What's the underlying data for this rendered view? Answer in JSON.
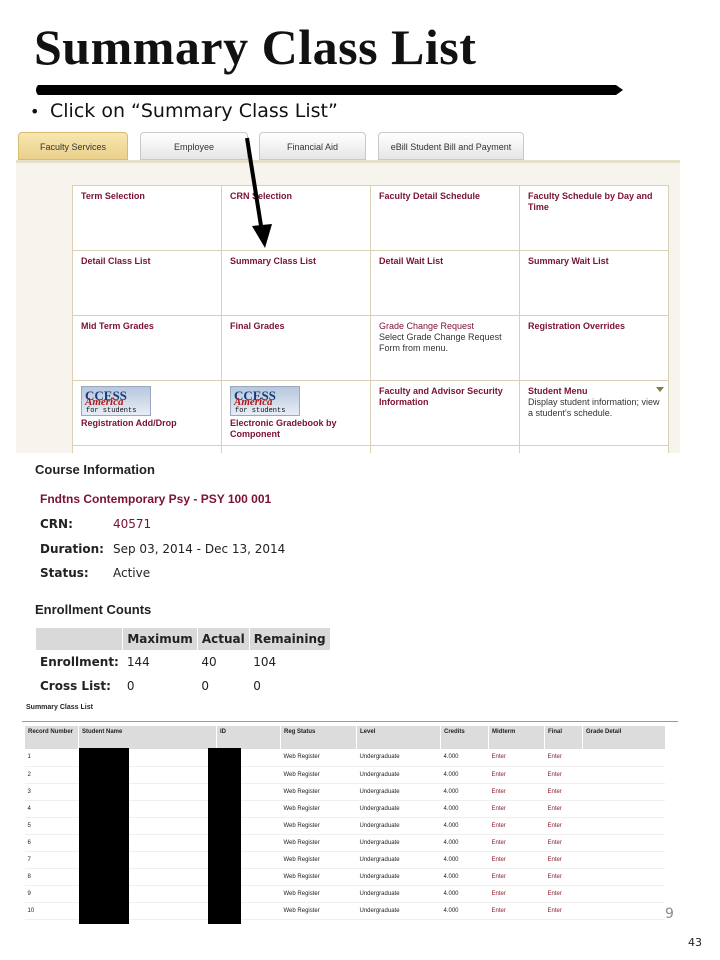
{
  "slide": {
    "title": "Summary Class List",
    "bullet": "Click on “Summary Class List”",
    "page_number": "9",
    "slide_number": "43"
  },
  "tabs": [
    {
      "label": "Faculty Services",
      "active": true
    },
    {
      "label": "Employee",
      "active": false
    },
    {
      "label": "Financial Aid",
      "active": false
    },
    {
      "label": "eBill Student Bill and Payment",
      "active": false
    }
  ],
  "menu": {
    "r1": [
      "Term Selection",
      "CRN Selection",
      "Faculty Detail Schedule",
      "Faculty Schedule by Day and Time"
    ],
    "r2": [
      "Detail Class List",
      "Summary Class List",
      "Detail Wait List",
      "Summary Wait List"
    ],
    "r3": {
      "c1": "Mid Term Grades",
      "c2": "Final Grades",
      "c3_link": "Grade Change Request",
      "c3_desc": "Select Grade Change Request Form from menu.",
      "c4": "Registration Overrides"
    },
    "r4": {
      "logo": {
        "line1": "CCESS",
        "line2": "America",
        "line3": "for students"
      },
      "c1": "Registration Add/Drop",
      "c2": "Electronic Gradebook by Component",
      "c3": "Faculty and Advisor Security Information",
      "c4_link": "Student Menu",
      "c4_desc": "Display student information; view a student's schedule."
    }
  },
  "course": {
    "heading": "Course Information",
    "title": "Fndtns Contemporary Psy - PSY 100 001",
    "crn_label": "CRN:",
    "crn": "40571",
    "duration_label": "Duration:",
    "duration": "Sep 03, 2014 - Dec 13, 2014",
    "status_label": "Status:",
    "status": "Active"
  },
  "enrollment": {
    "heading": "Enrollment Counts",
    "columns": [
      "Maximum",
      "Actual",
      "Remaining"
    ],
    "rows": [
      {
        "label": "Enrollment:",
        "values": [
          "144",
          "40",
          "104"
        ]
      },
      {
        "label": "Cross List:",
        "values": [
          "0",
          "0",
          "0"
        ]
      }
    ]
  },
  "class_list": {
    "title": "Summary Class List",
    "headers": [
      "Record Number",
      "Student Name",
      "ID",
      "Reg Status",
      "Level",
      "Credits",
      "Midterm",
      "Final",
      "Grade Detail"
    ],
    "rows": [
      [
        "1",
        "",
        "",
        "Web Register",
        "Undergraduate",
        "4.000",
        "Enter",
        "Enter",
        ""
      ],
      [
        "2",
        "",
        "",
        "Web Register",
        "Undergraduate",
        "4.000",
        "Enter",
        "Enter",
        ""
      ],
      [
        "3",
        "",
        "",
        "Web Register",
        "Undergraduate",
        "4.000",
        "Enter",
        "Enter",
        ""
      ],
      [
        "4",
        "",
        "",
        "Web Register",
        "Undergraduate",
        "4.000",
        "Enter",
        "Enter",
        ""
      ],
      [
        "5",
        "",
        "",
        "Web Register",
        "Undergraduate",
        "4.000",
        "Enter",
        "Enter",
        ""
      ],
      [
        "6",
        "",
        "",
        "Web Register",
        "Undergraduate",
        "4.000",
        "Enter",
        "Enter",
        ""
      ],
      [
        "7",
        "",
        "",
        "Web Register",
        "Undergraduate",
        "4.000",
        "Enter",
        "Enter",
        ""
      ],
      [
        "8",
        "",
        "",
        "Web Register",
        "Undergraduate",
        "4.000",
        "Enter",
        "Enter",
        ""
      ],
      [
        "9",
        "",
        "",
        "Web Register",
        "Undergraduate",
        "4.000",
        "Enter",
        "Enter",
        ""
      ],
      [
        "10",
        "",
        "",
        "Web Register",
        "Undergraduate",
        "4.000",
        "Enter",
        "Enter",
        ""
      ]
    ]
  },
  "colors": {
    "link": "#7a1230",
    "active_tab": "#ead08a",
    "grid_border": "#d9d0b8"
  }
}
